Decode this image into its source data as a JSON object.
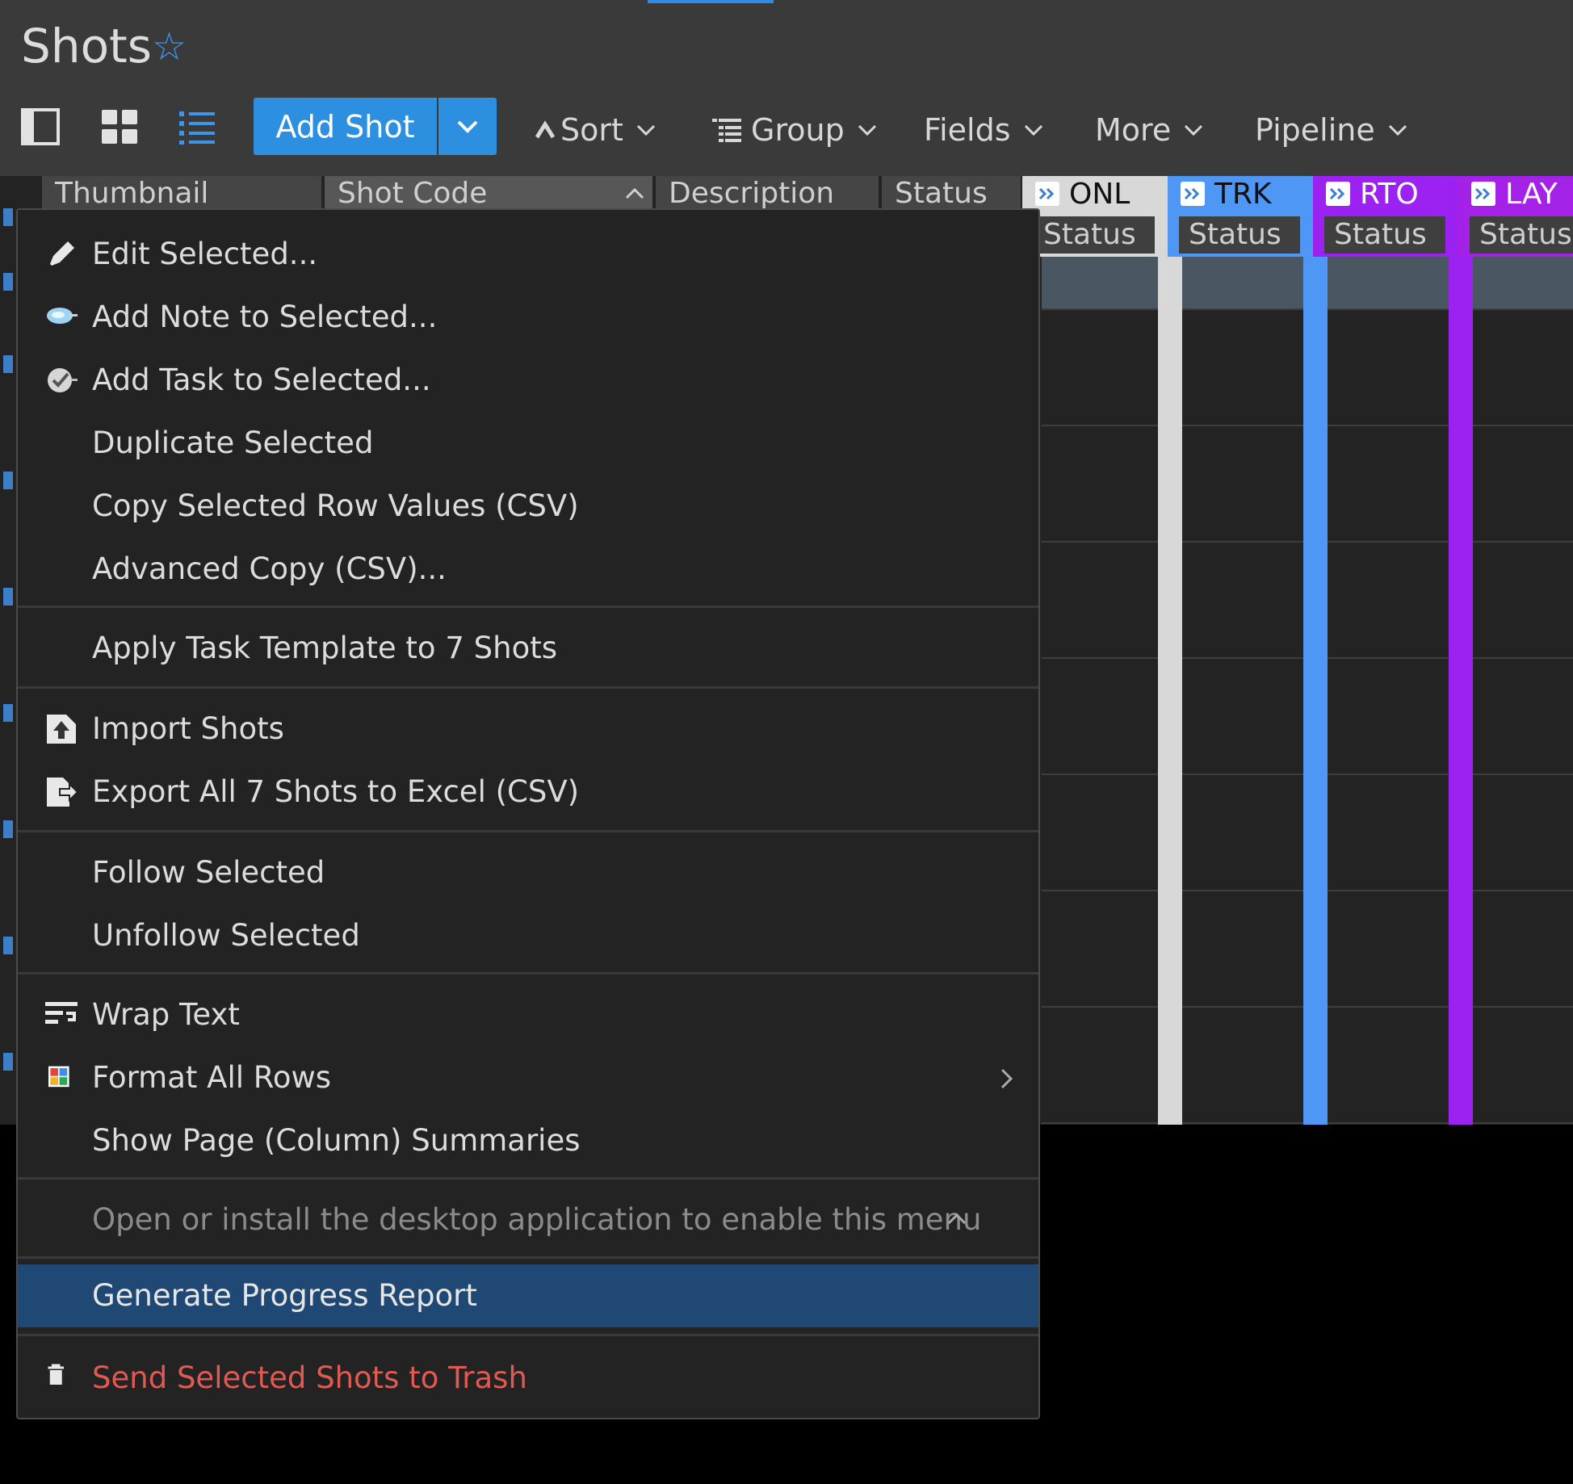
{
  "page": {
    "title": "Shots"
  },
  "toolbar": {
    "add_label": "Add Shot",
    "sort": "Sort",
    "group": "Group",
    "fields": "Fields",
    "more": "More",
    "pipeline": "Pipeline"
  },
  "grid": {
    "columns": [
      "Thumbnail",
      "Shot Code",
      "Description",
      "Status"
    ],
    "pipeline_steps": [
      {
        "code": "ONL",
        "sub": "Status",
        "color": "#d8d8d8"
      },
      {
        "code": "TRK",
        "sub": "Status",
        "color": "#4e97f4"
      },
      {
        "code": "RTO",
        "sub": "Status",
        "color": "#9b22f0"
      },
      {
        "code": "LAY",
        "sub": "Status",
        "color": "#a421e8"
      }
    ]
  },
  "menu": {
    "items": [
      {
        "label": "Edit Selected...",
        "icon": "pencil-icon"
      },
      {
        "label": "Add Note to Selected...",
        "icon": "note-icon"
      },
      {
        "label": "Add Task to Selected...",
        "icon": "task-check-icon"
      },
      {
        "label": "Duplicate Selected"
      },
      {
        "label": "Copy Selected Row Values (CSV)"
      },
      {
        "label": "Advanced Copy (CSV)..."
      },
      {
        "label": "Apply Task Template to 7 Shots"
      },
      {
        "label": "Import Shots",
        "icon": "import-icon"
      },
      {
        "label": "Export All 7 Shots to Excel (CSV)",
        "icon": "export-icon"
      },
      {
        "label": "Follow Selected"
      },
      {
        "label": "Unfollow Selected"
      },
      {
        "label": "Wrap Text",
        "icon": "wrap-text-icon"
      },
      {
        "label": "Format All Rows",
        "icon": "color-grid-icon",
        "submenu": true
      },
      {
        "label": "Show Page (Column) Summaries"
      },
      {
        "label": "Open or install the desktop application to enable this menu",
        "disabled": true
      },
      {
        "label": "Generate Progress Report",
        "highlighted": true
      },
      {
        "label": "Send Selected Shots to Trash",
        "icon": "trash-icon",
        "danger": true
      }
    ]
  },
  "colors": {
    "accent": "#2d8fe0",
    "highlight": "#1f4874",
    "danger": "#e05a52"
  }
}
